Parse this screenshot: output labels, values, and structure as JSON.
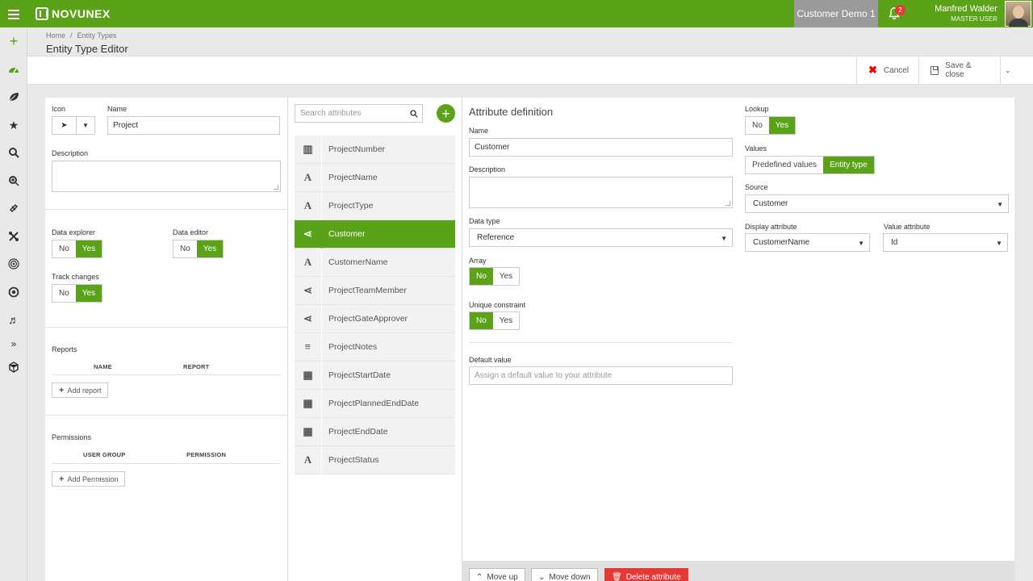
{
  "app": {
    "brand": "NOVUNEX",
    "tenant": "Customer Demo 1",
    "notifications_count": "2",
    "user_name": "Manfred Walder",
    "user_role": "MASTER USER"
  },
  "rail": {
    "items": [
      "plus-icon",
      "dashboard-icon",
      "leaf-icon",
      "star-icon",
      "search-icon",
      "zoom-icon",
      "link-icon",
      "tools-icon",
      "target-icon",
      "record-icon",
      "music-icon",
      "expand-icon",
      "cube-icon"
    ]
  },
  "header": {
    "breadcrumb": [
      "Home",
      "/",
      "Entity Types"
    ],
    "title": "Entity Type Editor"
  },
  "toolbar": {
    "cancel_label": "Cancel",
    "save_label": "Save & close"
  },
  "left": {
    "icon_label": "Icon",
    "name_label": "Name",
    "name_value": "Project",
    "description_label": "Description",
    "data_explorer_label": "Data explorer",
    "data_editor_label": "Data editor",
    "track_changes_label": "Track changes",
    "no": "No",
    "yes": "Yes",
    "reports_label": "Reports",
    "reports_cols": [
      "NAME",
      "REPORT"
    ],
    "add_report": "Add report",
    "permissions_label": "Permissions",
    "permissions_cols": [
      "USER GROUP",
      "PERMISSION"
    ],
    "add_permission": "Add Permission"
  },
  "middle": {
    "search_placeholder": "Search attributes",
    "attributes": [
      {
        "name": "ProjectNumber",
        "icon": "barcode-icon"
      },
      {
        "name": "ProjectName",
        "icon": "text-icon"
      },
      {
        "name": "ProjectType",
        "icon": "text-icon"
      },
      {
        "name": "Customer",
        "icon": "share-icon",
        "selected": true
      },
      {
        "name": "CustomerName",
        "icon": "text-icon"
      },
      {
        "name": "ProjectTeamMember",
        "icon": "share-icon"
      },
      {
        "name": "ProjectGateApprover",
        "icon": "share-icon"
      },
      {
        "name": "ProjectNotes",
        "icon": "paragraph-icon"
      },
      {
        "name": "ProjectStartDate",
        "icon": "calendar-icon"
      },
      {
        "name": "ProjectPlannedEndDate",
        "icon": "calendar-icon"
      },
      {
        "name": "ProjectEndDate",
        "icon": "calendar-icon"
      },
      {
        "name": "ProjectStatus",
        "icon": "text-icon"
      }
    ]
  },
  "right": {
    "section_title": "Attribute definition",
    "name_label": "Name",
    "name_value": "Customer",
    "description_label": "Description",
    "data_type_label": "Data type",
    "data_type_value": "Reference",
    "array_label": "Array",
    "unique_label": "Unique constraint",
    "default_label": "Default value",
    "default_placeholder": "Assign a default value to your attribute",
    "lookup_label": "Lookup",
    "values_label": "Values",
    "values_opt1": "Predefined values",
    "values_opt2": "Entity type",
    "source_label": "Source",
    "source_value": "Customer",
    "display_attr_label": "Display attribute",
    "display_attr_value": "CustomerName",
    "value_attr_label": "Value attribute",
    "value_attr_value": "Id",
    "no": "No",
    "yes": "Yes",
    "move_up": "Move up",
    "move_down": "Move down",
    "delete": "Delete attribute"
  },
  "colors": {
    "accent": "#5aa319",
    "danger": "#e53935",
    "tenant_bg": "#9a9a9a"
  }
}
